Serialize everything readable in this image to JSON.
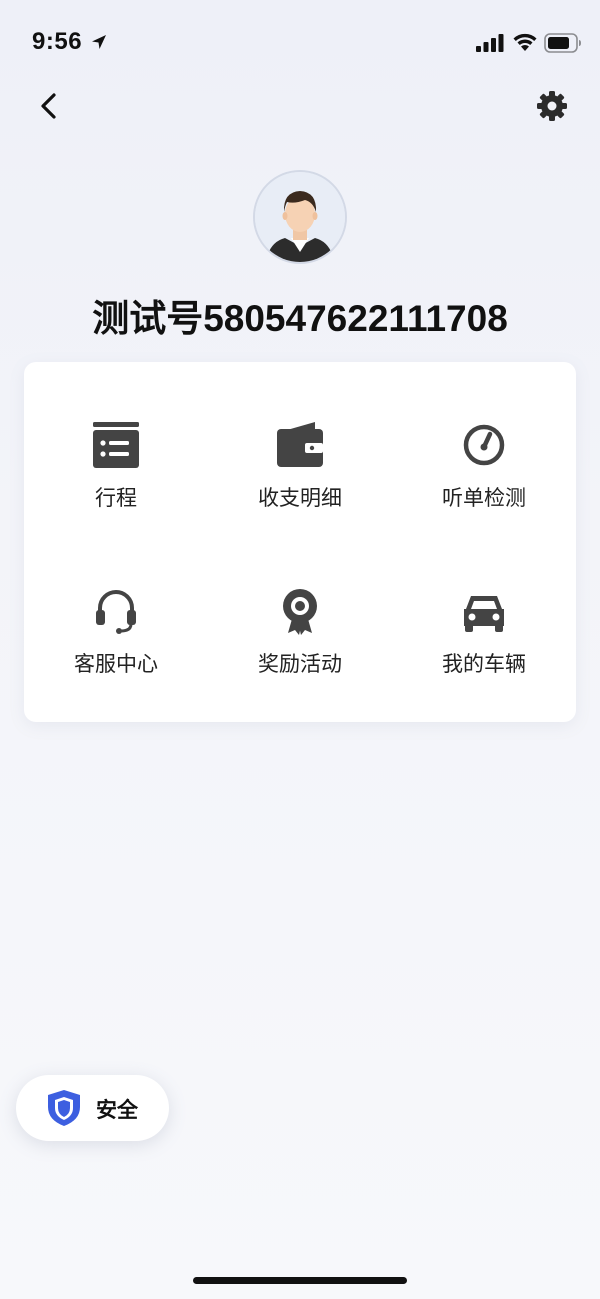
{
  "status_bar": {
    "time": "9:56",
    "icons": [
      "location-arrow-icon",
      "cellular-signal-icon",
      "wifi-icon",
      "battery-icon"
    ]
  },
  "nav": {
    "back_icon": "chevron-left-icon",
    "settings_icon": "gear-icon"
  },
  "profile": {
    "avatar_icon": "user-avatar",
    "name": "测试号580547622111708"
  },
  "menu": {
    "items": [
      {
        "label": "行程",
        "icon": "itinerary-list-icon"
      },
      {
        "label": "收支明细",
        "icon": "wallet-icon"
      },
      {
        "label": "听单检测",
        "icon": "gauge-icon"
      },
      {
        "label": "客服中心",
        "icon": "headset-icon"
      },
      {
        "label": "奖励活动",
        "icon": "award-badge-icon"
      },
      {
        "label": "我的车辆",
        "icon": "car-icon"
      }
    ]
  },
  "safety": {
    "label": "安全",
    "icon": "shield-icon",
    "accent_color": "#3d5fe0"
  },
  "colors": {
    "icon": "#444444",
    "background": "#f2f3f8"
  }
}
